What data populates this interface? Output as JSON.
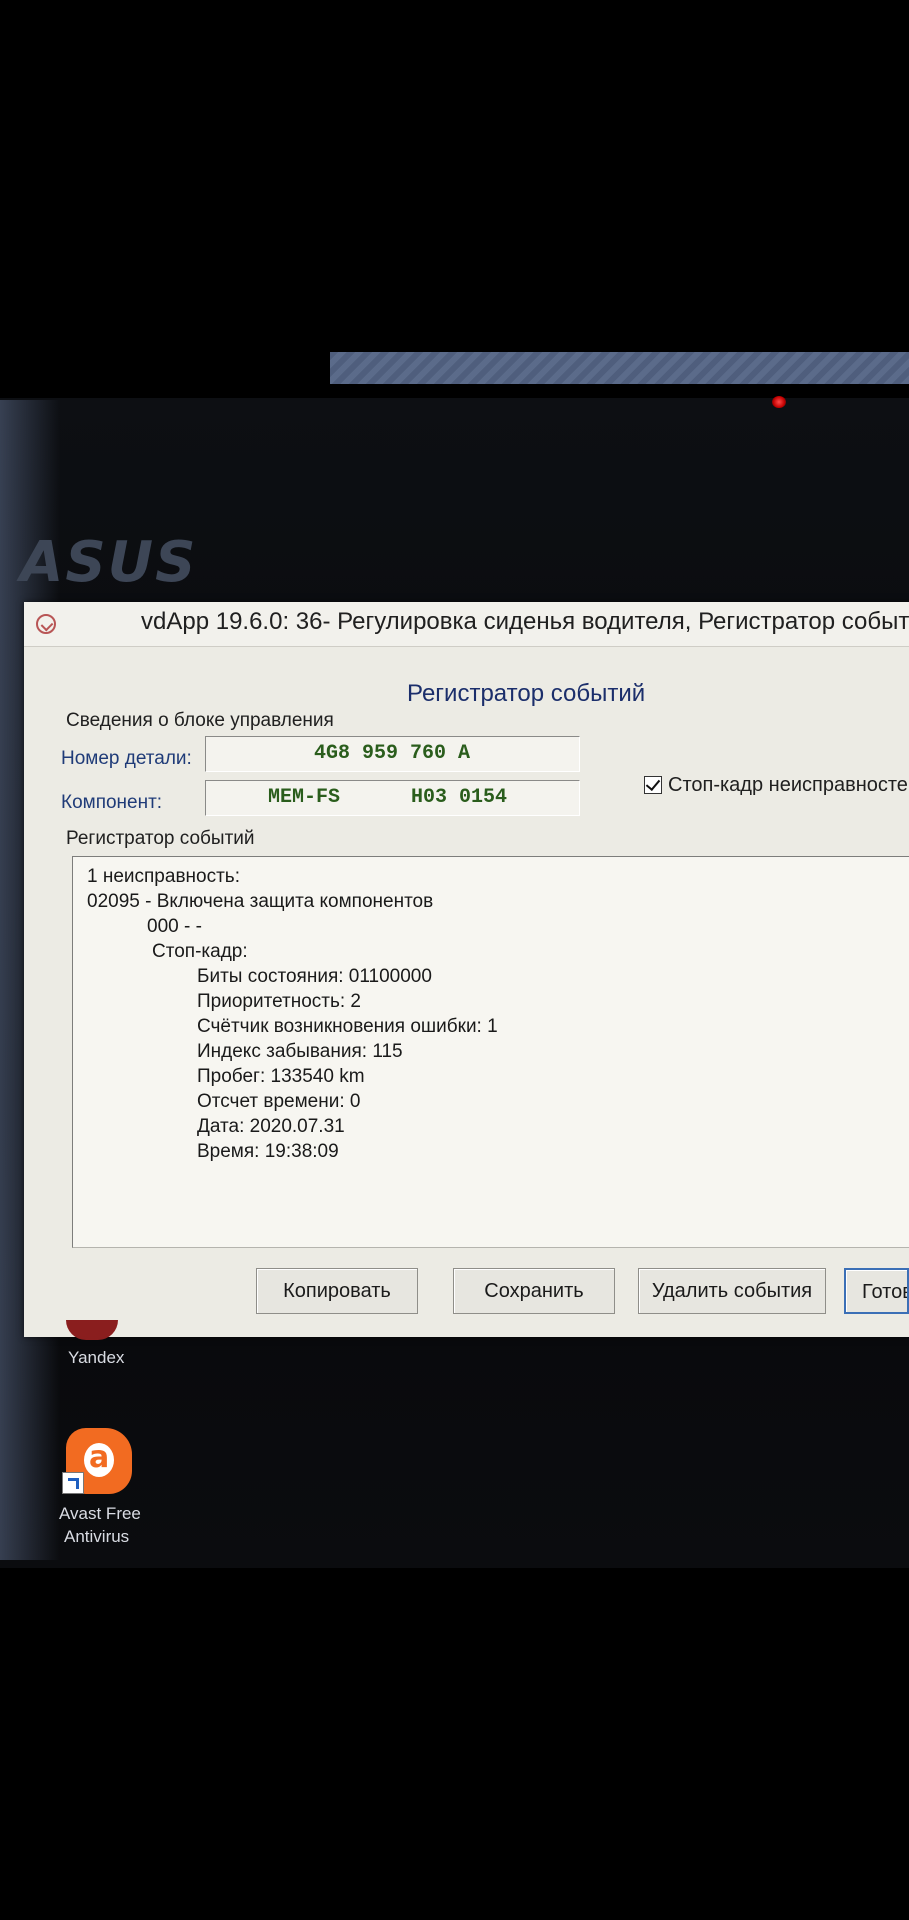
{
  "brand": "ASUS",
  "window": {
    "title": "vdApp 19.6.0: 36- Регулировка сиденья водителя,  Регистратор событи",
    "heading": "Регистратор событий"
  },
  "control_unit": {
    "group_label": "Сведения о блоке управления",
    "part_number_label": "Номер детали:",
    "part_number_value": "4G8 959 760 A",
    "component_label": "Компонент:",
    "component_name": "MEM-FS",
    "component_version": "H03 0154"
  },
  "freeze_frame_checkbox": {
    "label": "Стоп-кадр неисправносте",
    "checked": true
  },
  "event_log": {
    "label": "Регистратор событий",
    "lines": [
      "1 неисправность:",
      "02095 - Включена защита компонентов",
      "000 - -",
      "Стоп-кадр:",
      "Биты состояния: 01100000",
      "Приоритетность: 2",
      "Счётчик возникновения ошибки: 1",
      "Индекс забывания: 115",
      "Пробег: 133540 km",
      "Отсчет времени: 0",
      "Дата: 2020.07.31",
      "Время: 19:38:09"
    ]
  },
  "buttons": {
    "copy": "Копировать",
    "save": "Сохранить",
    "delete_events": "Удалить события",
    "done": "Готов"
  },
  "desktop_icons": {
    "yandex_label": "Yandex",
    "avast_label_line1": "Avast Free",
    "avast_label_line2": "Antivirus"
  }
}
